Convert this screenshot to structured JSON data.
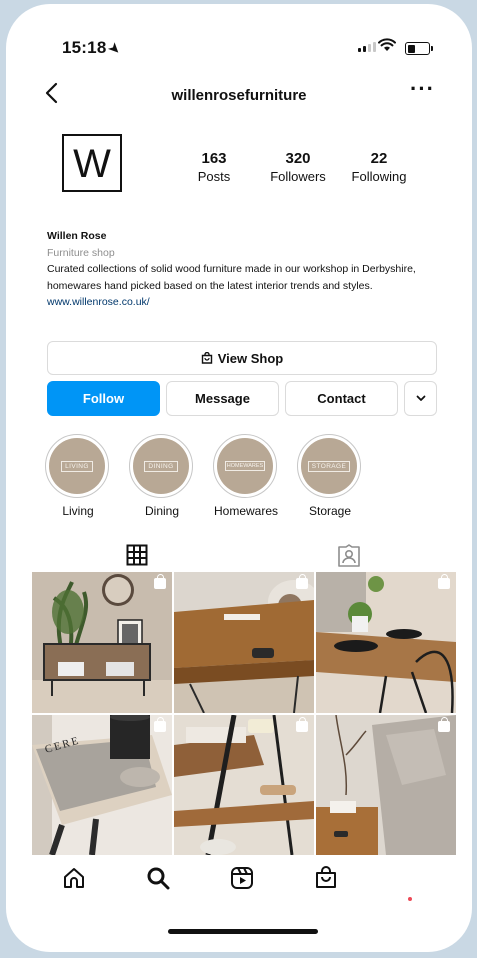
{
  "status": {
    "time": "15:18"
  },
  "header": {
    "username": "willenrosefurniture",
    "back_icon": "chevron-left-icon",
    "more_icon": "more-horizontal-icon"
  },
  "profile": {
    "logo_letter": "W",
    "stats": [
      {
        "value": "163",
        "label": "Posts"
      },
      {
        "value": "320",
        "label": "Followers"
      },
      {
        "value": "22",
        "label": "Following"
      }
    ]
  },
  "bio": {
    "name": "Willen Rose",
    "category": "Furniture shop",
    "text": "Curated collections of solid wood furniture made in our workshop in Derbyshire, homewares hand picked based on the latest interior trends and styles.",
    "link": "www.willenrose.co.uk/"
  },
  "buttons": {
    "view_shop": "View Shop",
    "follow": "Follow",
    "message": "Message",
    "contact": "Contact"
  },
  "highlights": [
    {
      "tag": "LIVING",
      "label": "Living"
    },
    {
      "tag": "DINING",
      "label": "Dining"
    },
    {
      "tag": "HOMEWARES",
      "label": "Homewares"
    },
    {
      "tag": "STORAGE",
      "label": "Storage"
    }
  ],
  "tabs": [
    "grid-icon",
    "tagged-icon"
  ],
  "posts": [
    {
      "subject": "TV stand with plant and mirror",
      "shop_icon": "shopping-bag-icon"
    },
    {
      "subject": "Rustic coffee table with hairpin legs",
      "shop_icon": "shopping-bag-icon"
    },
    {
      "subject": "Dining table with black chairs",
      "shop_icon": "shopping-bag-icon"
    },
    {
      "subject": "Book and candle on side table",
      "shop_icon": "shopping-bag-icon"
    },
    {
      "subject": "Ladder shelf with towels",
      "shop_icon": "shopping-bag-icon"
    },
    {
      "subject": "Bedside table beside sofa",
      "shop_icon": "shopping-bag-icon"
    }
  ],
  "bottom_nav": [
    "home-icon",
    "search-icon",
    "reels-icon",
    "shop-icon"
  ],
  "colors": {
    "follow": "#0095f6",
    "highlight_bg": "#b8a895",
    "link": "#00376b"
  }
}
